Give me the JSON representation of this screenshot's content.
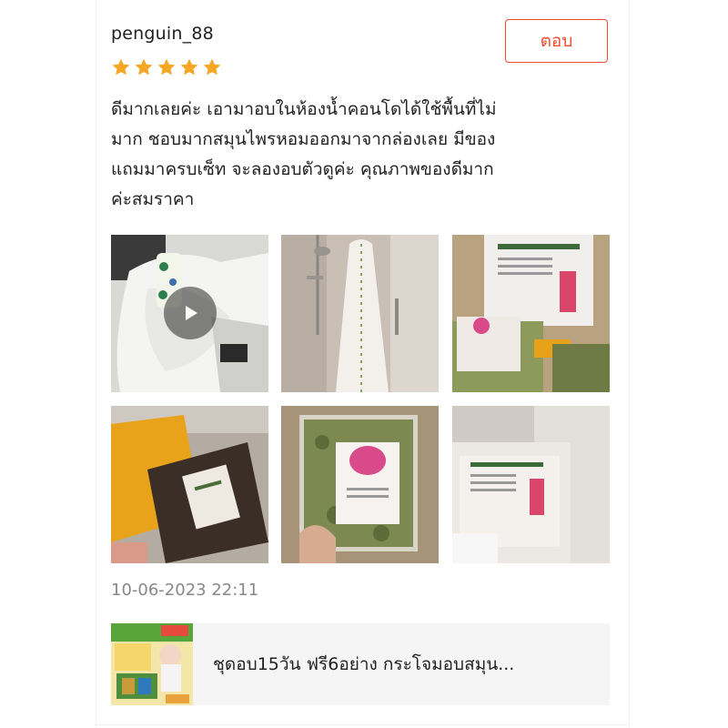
{
  "review": {
    "username": "penguin_88",
    "reply_label": "ตอบ",
    "rating": 5,
    "star_icon": "star-icon",
    "star_color": "#f5a623",
    "text_lines": [
      "ดีมากเลยค่ะ เอามาอบในห้องน้ำคอนโดได้ใช้พื้นที่ไม่",
      "มาก ชอบมากสมุนไพรหอมออกมาจากล่องเลย มีของ",
      "แถมมาครบเซ็ท จะลองอบตัวดูค่ะ คุณภาพของดีมาก",
      "ค่ะสมราคา"
    ],
    "timestamp": "10-06-2023 22:11",
    "media_count": 6,
    "first_media_is_video": true
  },
  "product": {
    "name": "ชุดอบ15วัน ฟรี6อย่าง กระโจมอบสมุน..."
  },
  "colors": {
    "accent": "#ee4d2d",
    "text": "#222222",
    "muted": "#888888",
    "panel": "#f5f5f5"
  }
}
